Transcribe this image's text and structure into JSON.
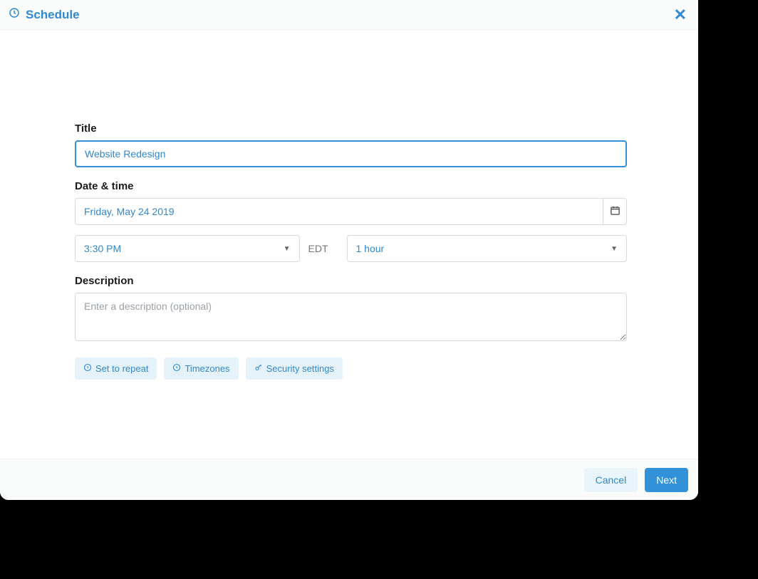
{
  "header": {
    "title": "Schedule"
  },
  "form": {
    "title_label": "Title",
    "title_value": "Website Redesign",
    "datetime_label": "Date & time",
    "date_value": "Friday, May 24 2019",
    "time_value": "3:30 PM",
    "timezone": "EDT",
    "duration_value": "1 hour",
    "description_label": "Description",
    "description_placeholder": "Enter a description (optional)",
    "description_value": ""
  },
  "options": {
    "repeat": "Set to repeat",
    "timezones": "Timezones",
    "security": "Security settings"
  },
  "footer": {
    "cancel": "Cancel",
    "next": "Next"
  }
}
